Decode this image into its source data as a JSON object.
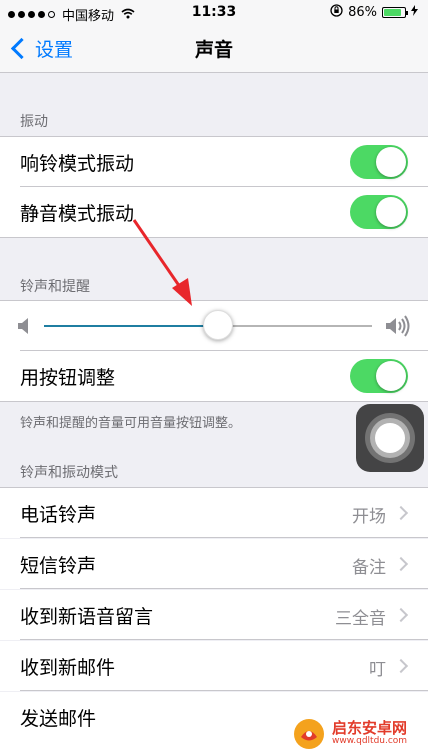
{
  "status_bar": {
    "carrier": "中国移动",
    "time": "11:33",
    "battery_percent": "86%",
    "battery_level": 0.86
  },
  "nav": {
    "back_label": "设置",
    "title": "声音"
  },
  "vibrate_section": {
    "header": "振动",
    "items": [
      {
        "label": "响铃模式振动",
        "on": true
      },
      {
        "label": "静音模式振动",
        "on": true
      }
    ]
  },
  "ringer_section": {
    "header": "铃声和提醒",
    "volume_level": 0.53,
    "change_with_buttons": {
      "label": "用按钮调整",
      "on": true
    },
    "footer": "铃声和提醒的音量可用音量按钮调整。"
  },
  "sounds_section": {
    "header": "铃声和振动模式",
    "items": [
      {
        "label": "电话铃声",
        "value": "开场"
      },
      {
        "label": "短信铃声",
        "value": "备注"
      },
      {
        "label": "收到新语音留言",
        "value": "三全音"
      },
      {
        "label": "收到新邮件",
        "value": "叮"
      },
      {
        "label": "发送邮件",
        "value": ""
      }
    ]
  },
  "watermark": {
    "name": "启东安卓网",
    "url": "www.qdltdu.com"
  },
  "colors": {
    "accent": "#007aff",
    "toggle_on": "#4cd964",
    "annotation_arrow": "#e8262b"
  }
}
